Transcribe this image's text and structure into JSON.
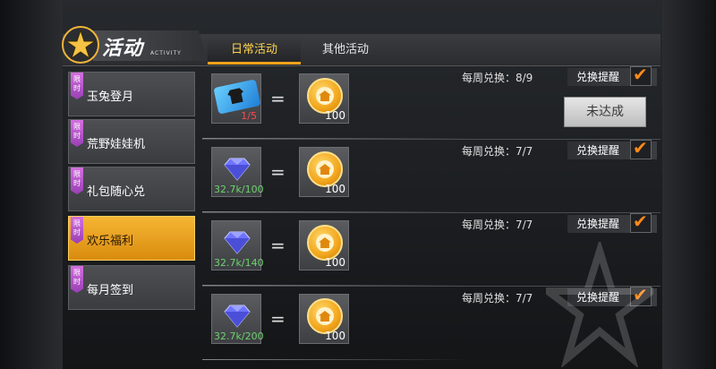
{
  "header": {
    "title": "活动",
    "subtitle": "ACTIVITY",
    "tabs": [
      {
        "label": "日常活动",
        "active": true
      },
      {
        "label": "其他活动",
        "active": false
      }
    ]
  },
  "sidebar": {
    "items": [
      {
        "tag": "限时",
        "label": "玉兔登月",
        "active": false
      },
      {
        "tag": "限时",
        "label": "荒野娃娃机",
        "active": false
      },
      {
        "tag": "限时",
        "label": "礼包随心兑",
        "active": false
      },
      {
        "tag": "限时",
        "label": "欢乐福利",
        "active": true
      },
      {
        "tag": "限时",
        "label": "每月签到",
        "active": false
      }
    ]
  },
  "rows": [
    {
      "item_icon": "ticket-icon",
      "item_count": "1/5",
      "reward_count": "100",
      "weekly": "每周兑换：8/9",
      "remind_label": "兑换提醒",
      "button_label": "未达成"
    },
    {
      "item_icon": "diamond-icon",
      "item_count": "32.7k/100",
      "reward_count": "100",
      "weekly": "每周兑换：7/7",
      "remind_label": "兑换提醒"
    },
    {
      "item_icon": "diamond-icon",
      "item_count": "32.7k/140",
      "reward_count": "100",
      "weekly": "每周兑换：7/7",
      "remind_label": "兑换提醒"
    },
    {
      "item_icon": "diamond-icon",
      "item_count": "32.7k/200",
      "reward_count": "100",
      "weekly": "每周兑换：7/7",
      "remind_label": "兑换提醒"
    }
  ],
  "symbols": {
    "equals": "=",
    "check": "✔"
  },
  "colors": {
    "accent": "#f0a21a",
    "active_tab_text": "#ffd34d",
    "tag_purple": "#b455cc",
    "count_green": "#6cd36c",
    "count_red": "#ff4a4a"
  }
}
